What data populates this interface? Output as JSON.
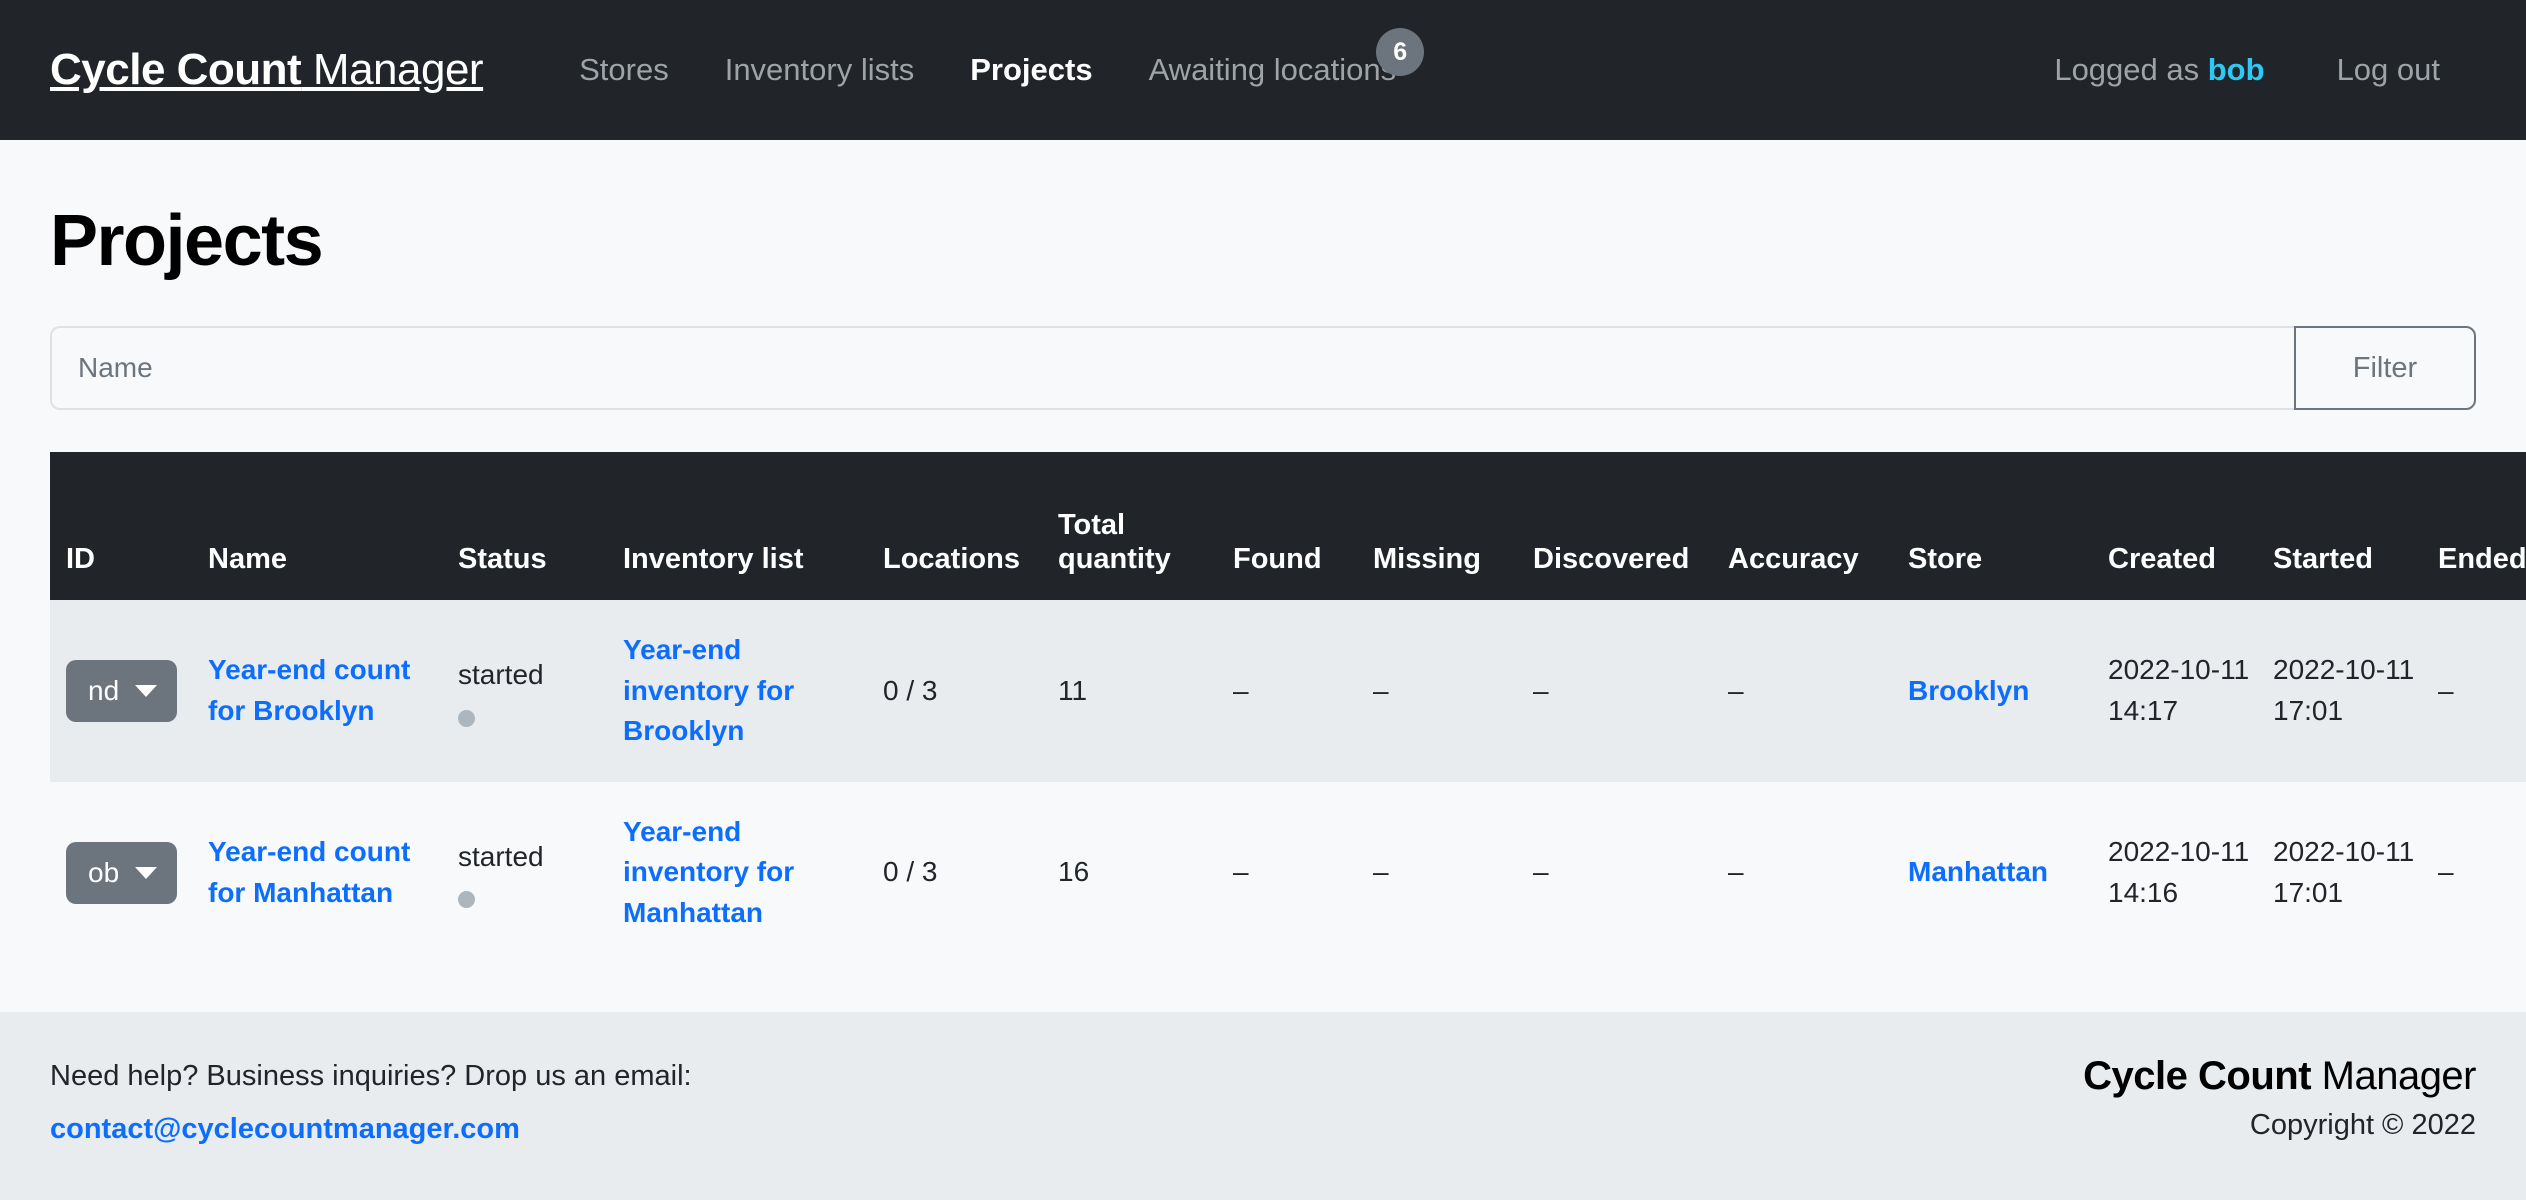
{
  "navbar": {
    "brand": {
      "strong": "Cycle Count",
      "light": " Manager"
    },
    "links": [
      {
        "label": "Stores",
        "active": false
      },
      {
        "label": "Inventory lists",
        "active": false
      },
      {
        "label": "Projects",
        "active": true
      },
      {
        "label": "Awaiting locations",
        "active": false,
        "badge": "6"
      }
    ],
    "logged_as_prefix": "Logged as ",
    "user": "bob",
    "logout_label": "Log out"
  },
  "page": {
    "title": "Projects"
  },
  "filter": {
    "placeholder": "Name",
    "value": "",
    "button_label": "Filter"
  },
  "table": {
    "columns": [
      "ID",
      "Name",
      "Status",
      "Inventory list",
      "Locations",
      "Total quantity",
      "Found",
      "Missing",
      "Discovered",
      "Accuracy",
      "Store",
      "Created",
      "Started",
      "Ended"
    ],
    "rows": [
      {
        "id": "nd",
        "name": "Year-end count for Brooklyn",
        "status": "started",
        "inventory_list": "Year-end inventory for Brooklyn",
        "locations": "0 / 3",
        "total_quantity": "11",
        "found": "–",
        "missing": "–",
        "discovered": "–",
        "accuracy": "–",
        "store": "Brooklyn",
        "created": "2022-10-11 14:17",
        "started": "2022-10-11 17:01",
        "ended": "–"
      },
      {
        "id": "ob",
        "name": "Year-end count for Manhattan",
        "status": "started",
        "inventory_list": "Year-end inventory for Manhattan",
        "locations": "0 / 3",
        "total_quantity": "16",
        "found": "–",
        "missing": "–",
        "discovered": "–",
        "accuracy": "–",
        "store": "Manhattan",
        "created": "2022-10-11 14:16",
        "started": "2022-10-11 17:01",
        "ended": "–"
      }
    ]
  },
  "footer": {
    "help_text": "Need help? Business inquiries? Drop us an email:",
    "email": "contact@cyclecountmanager.com",
    "brand": {
      "strong": "Cycle Count",
      "light": " Manager"
    },
    "copyright": "Copyright © 2022"
  },
  "colors": {
    "navbar_bg": "#212529",
    "link_blue": "#0d6efd",
    "user_cyan": "#2bc9f4",
    "muted_gray": "#6c757d",
    "row_odd_bg": "#e9ecef",
    "row_even_bg": "#f8f9fa",
    "page_bg": "#f8f9fa"
  }
}
